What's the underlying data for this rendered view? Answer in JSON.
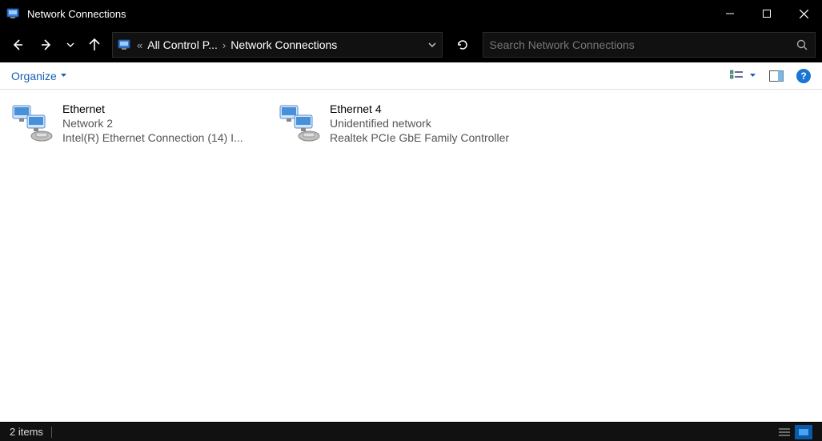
{
  "window": {
    "title": "Network Connections"
  },
  "breadcrumb": {
    "item1": "All Control P...",
    "item2": "Network Connections"
  },
  "search": {
    "placeholder": "Search Network Connections"
  },
  "toolbar": {
    "organize_label": "Organize"
  },
  "items": [
    {
      "name": "Ethernet",
      "status": "Network 2",
      "device": "Intel(R) Ethernet Connection (14) I..."
    },
    {
      "name": "Ethernet 4",
      "status": "Unidentified network",
      "device": "Realtek PCIe GbE Family Controller"
    }
  ],
  "status": {
    "text": "2 items"
  }
}
